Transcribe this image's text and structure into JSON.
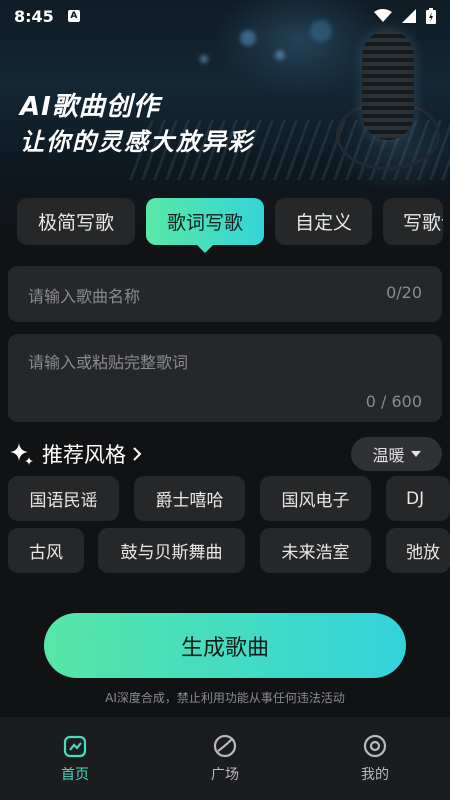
{
  "status_bar": {
    "time": "8:45",
    "notification_icon": "A"
  },
  "hero": {
    "title": "AI歌曲创作",
    "subtitle": "让你的灵感大放异彩"
  },
  "mode_tabs": [
    {
      "label": "极简写歌",
      "active": false
    },
    {
      "label": "歌词写歌",
      "active": true
    },
    {
      "label": "自定义",
      "active": false
    },
    {
      "label": "写歌词",
      "active": false
    }
  ],
  "song_title_input": {
    "placeholder": "请输入歌曲名称",
    "counter": "0/20"
  },
  "lyrics_input": {
    "placeholder": "请输入或粘贴完整歌词",
    "counter": "0 / 600"
  },
  "styles": {
    "heading": "推荐风格",
    "mood_dropdown": "温暖",
    "row1": [
      "国语民谣",
      "爵士嘻哈",
      "国风电子",
      "DJ"
    ],
    "row2": [
      "古风",
      "鼓与贝斯舞曲",
      "未来浩室",
      "弛放"
    ]
  },
  "generate_button": "生成歌曲",
  "disclaimer": "AI深度合成，禁止利用功能从事任何违法活动",
  "bottom_nav": [
    {
      "label": "首页",
      "icon": "home-icon",
      "active": true
    },
    {
      "label": "广场",
      "icon": "plaza-icon",
      "active": false
    },
    {
      "label": "我的",
      "icon": "profile-icon",
      "active": false
    }
  ],
  "colors": {
    "accent_start": "#56e6a6",
    "accent_end": "#33d3dc",
    "background": "#111214",
    "card": "#262729"
  }
}
